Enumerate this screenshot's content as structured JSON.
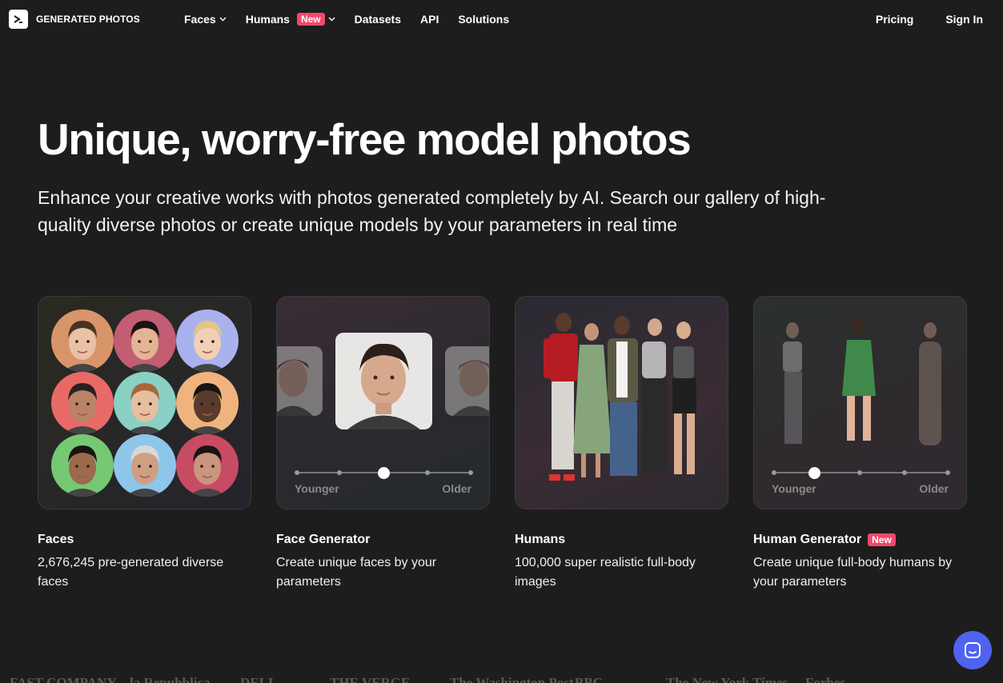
{
  "brand": {
    "name": "GENERATED PHOTOS"
  },
  "nav": {
    "items": [
      {
        "label": "Faces",
        "dropdown": true
      },
      {
        "label": "Humans",
        "badge": "New",
        "dropdown": true
      },
      {
        "label": "Datasets"
      },
      {
        "label": "API"
      },
      {
        "label": "Solutions"
      }
    ],
    "pricing": "Pricing",
    "sign_in": "Sign In"
  },
  "hero": {
    "title": "Unique, worry-free model photos",
    "subtitle": "Enhance your creative works with photos generated completely by AI. Search our gallery of high-quality diverse photos or create unique models by your parameters in real time"
  },
  "cards": [
    {
      "title": "Faces",
      "description": "2,676,245 pre-generated diverse faces"
    },
    {
      "title": "Face Generator",
      "description": "Create unique faces by your parameters",
      "slider": {
        "min_label": "Younger",
        "max_label": "Older",
        "position": 0.5
      }
    },
    {
      "title": "Humans",
      "description": "100,000 super realistic full-body images"
    },
    {
      "title": "Human Generator",
      "badge": "New",
      "description": "Create unique full-body humans by your parameters",
      "slider": {
        "min_label": "Younger",
        "max_label": "Older",
        "position": 0.25
      }
    }
  ],
  "press_logos": [
    "FAST COMPANY",
    "la Repubblica",
    "DELL",
    "THE VERGE",
    "The Washington Post",
    "BBC",
    "The New York Times",
    "Forbes"
  ],
  "colors": {
    "background": "#1d1d1d",
    "badge": "#f0486b",
    "chat_button": "#4f63f0"
  },
  "icons": {
    "chat": "chat-bubble-icon",
    "chevron": "chevron-down-icon"
  }
}
